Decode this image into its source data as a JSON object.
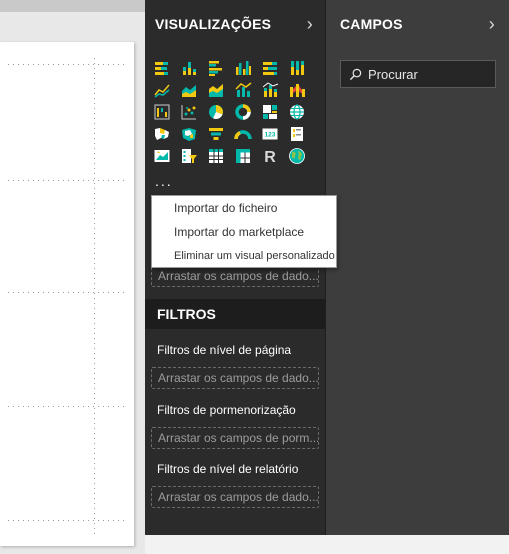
{
  "visualizations": {
    "title": "VISUALIZAÇÕES",
    "icons": [
      "stacked-bar-icon",
      "stacked-column-icon",
      "clustered-bar-icon",
      "clustered-column-icon",
      "100-stacked-bar-icon",
      "100-stacked-column-icon",
      "line-chart-icon",
      "area-chart-icon",
      "stacked-area-icon",
      "line-clustered-column-icon",
      "line-stacked-column-icon",
      "ribbon-chart-icon",
      "waterfall-icon",
      "scatter-icon",
      "pie-chart-icon",
      "donut-chart-icon",
      "treemap-icon",
      "map-icon",
      "filled-map-icon",
      "shape-map-icon",
      "funnel-icon",
      "gauge-icon",
      "card-icon",
      "multi-row-card-icon",
      "kpi-icon",
      "slicer-icon",
      "table-icon",
      "matrix-icon",
      "r-visual-icon",
      "globe-icon"
    ],
    "more_label": "...",
    "fields_dropzone": "Arrastar os campos de dado..."
  },
  "context_menu": {
    "items": [
      "Importar do ficheiro",
      "Importar do marketplace",
      "Eliminar um visual personalizado"
    ]
  },
  "filters": {
    "title": "FILTROS",
    "page_label": "Filtros de nível de página",
    "page_dropzone": "Arrastar os campos de dado...",
    "drill_label": "Filtros de pormenorização",
    "drill_dropzone": "Arrastar os campos de porm...",
    "report_label": "Filtros de nível de relatório",
    "report_dropzone": "Arrastar os campos de dado..."
  },
  "fields": {
    "title": "CAMPOS",
    "search_placeholder": "Procurar"
  },
  "colors": {
    "accent_yellow": "#F2C811",
    "accent_teal": "#01B8AA",
    "pane_dark": "#2B2B2B",
    "fields_pane": "#3D3D3D"
  }
}
